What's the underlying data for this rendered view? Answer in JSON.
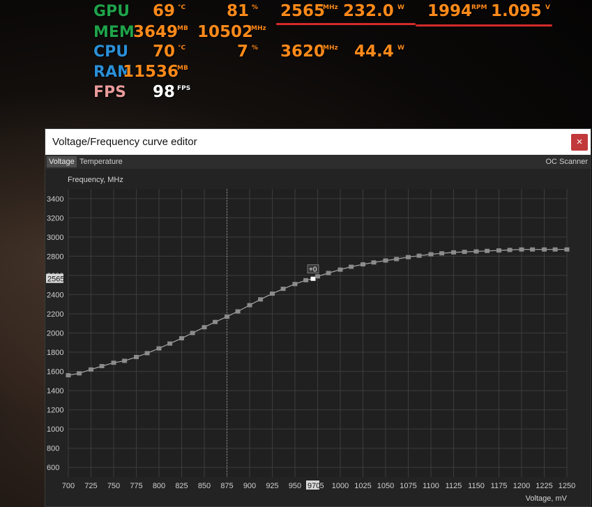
{
  "osd": {
    "rows": [
      {
        "label": "GPU",
        "label_color": "#1fa24a",
        "cells": [
          {
            "value": "69",
            "unit": "°C"
          },
          {
            "value": "81",
            "unit": "%"
          },
          {
            "value": "2565",
            "unit": "MHz"
          },
          {
            "value": "232.0",
            "unit": "W"
          },
          {
            "value": "1994",
            "unit": "RPM"
          },
          {
            "value": "1.095",
            "unit": "V"
          }
        ]
      },
      {
        "label": "MEM",
        "label_color": "#1fa24a",
        "cells": [
          {
            "value": "3649",
            "unit": "MB"
          },
          {
            "value": "10502",
            "unit": "MHz"
          }
        ]
      },
      {
        "label": "CPU",
        "label_color": "#2b8fd6",
        "cells": [
          {
            "value": "70",
            "unit": "°C"
          },
          {
            "value": "7",
            "unit": "%"
          },
          {
            "value": "3620",
            "unit": "MHz"
          },
          {
            "value": "44.4",
            "unit": "W"
          }
        ]
      },
      {
        "label": "RAM",
        "label_color": "#2b8fd6",
        "cells": [
          {
            "value": "11536",
            "unit": "MB"
          }
        ]
      },
      {
        "label": "FPS",
        "label_color": "#e89a9a",
        "cells": [
          {
            "value": "98",
            "unit": "FPS"
          }
        ]
      }
    ],
    "value_color": "#ff8a1a",
    "fps_value_color": "#ffffff",
    "highlight_color": "#d42a2a"
  },
  "window": {
    "title": "Voltage/Frequency curve editor",
    "close_label": "×",
    "tabs": [
      {
        "label": "Voltage",
        "active": true
      },
      {
        "label": "Temperature",
        "active": false
      }
    ],
    "oc_scanner_label": "OC Scanner",
    "y_title": "Frequency, MHz",
    "x_title": "Voltage, mV",
    "current_freq_label": "2565",
    "current_volt_label": "970",
    "point_offset_label": "+0"
  },
  "chart_data": {
    "type": "line",
    "title": "",
    "xlabel": "Voltage, mV",
    "ylabel": "Frequency, MHz",
    "xlim": [
      700,
      1250
    ],
    "ylim": [
      500,
      3500
    ],
    "xticks": [
      "700",
      "725",
      "750",
      "775",
      "800",
      "825",
      "850",
      "875",
      "900",
      "925",
      "950",
      "975",
      "1000",
      "1025",
      "1050",
      "1075",
      "1100",
      "1125",
      "1150",
      "1175",
      "1200",
      "1225",
      "1250"
    ],
    "yticks": [
      "3400",
      "3200",
      "3000",
      "2800",
      "2600",
      "2400",
      "2200",
      "2000",
      "1800",
      "1600",
      "1400",
      "1200",
      "1000",
      "800",
      "600"
    ],
    "grid": true,
    "marker_voltage": 875,
    "selected_point": {
      "x": 970,
      "y": 2565
    },
    "points": [
      [
        700,
        1560
      ],
      [
        712,
        1580
      ],
      [
        725,
        1620
      ],
      [
        737,
        1655
      ],
      [
        750,
        1690
      ],
      [
        762,
        1710
      ],
      [
        775,
        1750
      ],
      [
        787,
        1790
      ],
      [
        800,
        1840
      ],
      [
        812,
        1890
      ],
      [
        825,
        1945
      ],
      [
        837,
        2000
      ],
      [
        850,
        2060
      ],
      [
        862,
        2115
      ],
      [
        875,
        2170
      ],
      [
        887,
        2225
      ],
      [
        900,
        2290
      ],
      [
        912,
        2350
      ],
      [
        925,
        2410
      ],
      [
        937,
        2460
      ],
      [
        950,
        2510
      ],
      [
        962,
        2550
      ],
      [
        970,
        2565
      ],
      [
        975,
        2590
      ],
      [
        987,
        2625
      ],
      [
        1000,
        2660
      ],
      [
        1012,
        2690
      ],
      [
        1025,
        2715
      ],
      [
        1037,
        2735
      ],
      [
        1050,
        2755
      ],
      [
        1062,
        2770
      ],
      [
        1075,
        2790
      ],
      [
        1087,
        2805
      ],
      [
        1100,
        2820
      ],
      [
        1112,
        2830
      ],
      [
        1125,
        2840
      ],
      [
        1137,
        2845
      ],
      [
        1150,
        2850
      ],
      [
        1162,
        2855
      ],
      [
        1175,
        2860
      ],
      [
        1187,
        2865
      ],
      [
        1200,
        2870
      ],
      [
        1212,
        2870
      ],
      [
        1225,
        2870
      ],
      [
        1237,
        2870
      ],
      [
        1250,
        2870
      ]
    ]
  }
}
